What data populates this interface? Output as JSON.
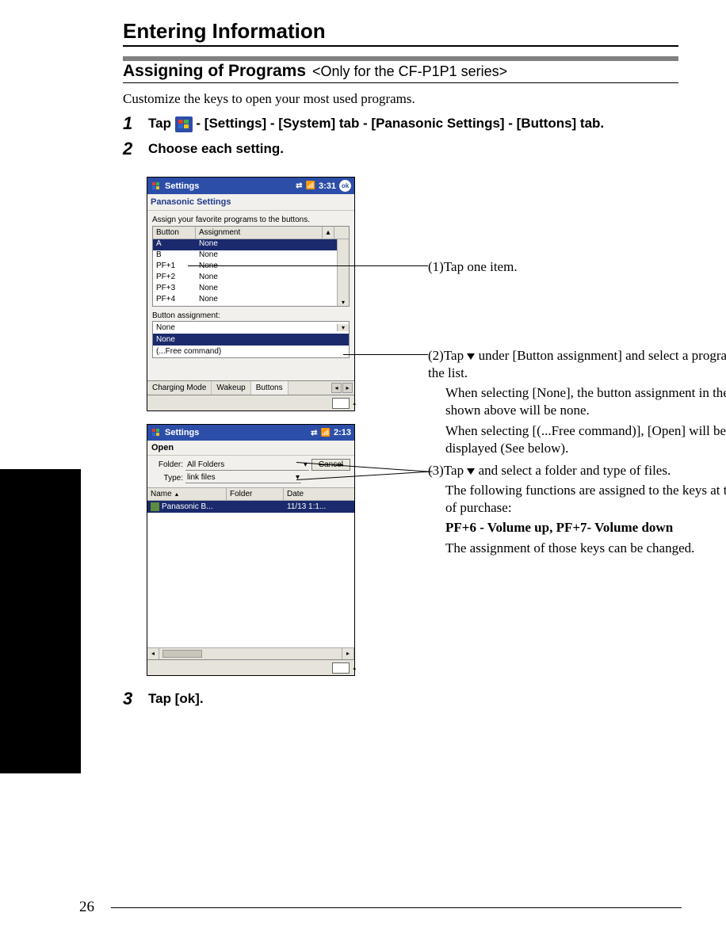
{
  "title": "Entering Information",
  "subtitle": "Assigning of Programs",
  "subtitle_note": "<Only for the CF-P1P1 series>",
  "intro": "Customize the keys to open your most used programs.",
  "steps": {
    "s1": {
      "num": "1",
      "before": "Tap ",
      "after": " - [Settings] - [System] tab - [Panasonic Settings] - [Buttons] tab."
    },
    "s2": {
      "num": "2",
      "text": "Choose each setting."
    },
    "s3": {
      "num": "3",
      "text": "Tap [ok]."
    }
  },
  "shot1": {
    "title": "Settings",
    "time": "3:31",
    "ok": "ok",
    "sub": "Panasonic Settings",
    "desc": "Assign your favorite programs to the buttons.",
    "col_button": "Button",
    "col_assign": "Assignment",
    "rows": [
      {
        "b": "A",
        "a": "None"
      },
      {
        "b": "B",
        "a": "None"
      },
      {
        "b": "PF+1",
        "a": "None"
      },
      {
        "b": "PF+2",
        "a": "None"
      },
      {
        "b": "PF+3",
        "a": "None"
      },
      {
        "b": "PF+4",
        "a": "None"
      }
    ],
    "assign_lbl": "Button assignment:",
    "assign_val": "None",
    "opt_sel": "None",
    "opt_free": "(...Free command)",
    "tabs": {
      "a": "Charging Mode",
      "b": "Wakeup",
      "c": "Buttons"
    }
  },
  "shot2": {
    "title": "Settings",
    "time": "2:13",
    "open": "Open",
    "folder_lbl": "Folder:",
    "folder_val": "All Folders",
    "cancel": "Cancel",
    "type_lbl": "Type:",
    "type_val": "link files",
    "cols": {
      "name": "Name",
      "folder": "Folder",
      "date": "Date"
    },
    "row": {
      "name": "Panasonic B...",
      "folder": "",
      "date": "11/13 1:1..."
    }
  },
  "callouts": {
    "c1": "(1)Tap one item.",
    "c2a": "(2)Tap ",
    "c2b": " under [Button assignment] and select a program from the list.",
    "c2c": "When selecting [None], the button assignment in the list shown above will be none.",
    "c2d": "When selecting [(...Free command)], [Open] will be displayed (See below).",
    "c3a": "(3)Tap ",
    "c3b": " and select a folder and type of files.",
    "c3c": "The following functions are assigned to the keys at the time of purchase:",
    "c3d": "PF+6 - Volume up, PF+7- Volume down",
    "c3e": "The assignment of those keys can be changed."
  },
  "page_number": "26"
}
